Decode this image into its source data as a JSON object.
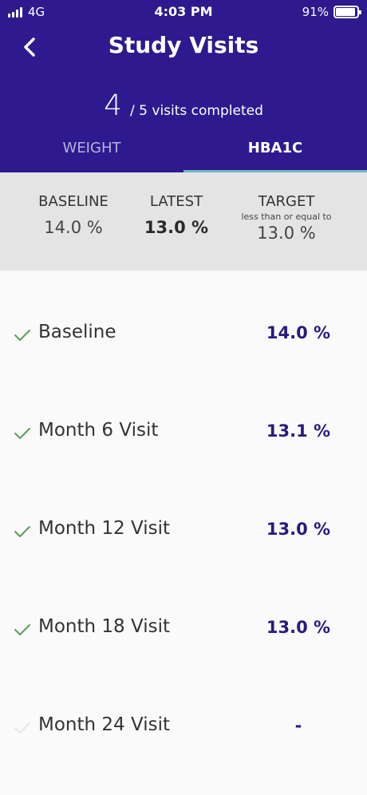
{
  "status_bar": {
    "network": "4G",
    "time": "4:03 PM",
    "battery_pct": "91%",
    "battery_level": 0.91
  },
  "header": {
    "title": "Study Visits",
    "visits_completed": "4",
    "visits_text": "/ 5 visits completed"
  },
  "tabs": [
    {
      "label": "WEIGHT",
      "active": false
    },
    {
      "label": "HBA1C",
      "active": true
    }
  ],
  "stats": {
    "baseline_label": "BASELINE",
    "baseline_value": "14.0 %",
    "latest_label": "LATEST",
    "latest_value": "13.0 %",
    "target_label": "TARGET",
    "target_sub": "less than or equal to",
    "target_value": "13.0 %"
  },
  "visits": [
    {
      "name": "Baseline",
      "value": "14.0 %",
      "completed": true
    },
    {
      "name": "Month 6 Visit",
      "value": "13.1 %",
      "completed": true
    },
    {
      "name": "Month 12 Visit",
      "value": "13.0 %",
      "completed": true
    },
    {
      "name": "Month 18 Visit",
      "value": "13.0 %",
      "completed": true
    },
    {
      "name": "Month 24 Visit",
      "value": "-",
      "completed": false
    }
  ],
  "colors": {
    "header_bg": "#2e1a8e",
    "accent_value": "#2b1a7e",
    "check_done": "#5a9e5a",
    "check_pending": "#e8e8e8",
    "tab_indicator": "#6fb5c3"
  },
  "icons": {
    "back": "chevron-left-icon",
    "check": "check-icon",
    "signal": "signal-icon",
    "battery": "battery-icon"
  }
}
